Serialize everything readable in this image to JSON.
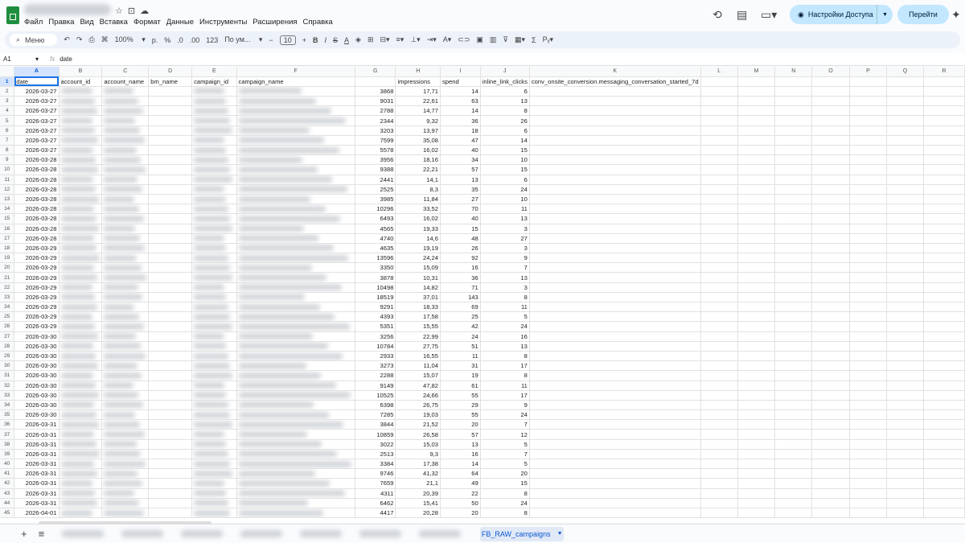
{
  "app": {
    "menu": [
      "Файл",
      "Правка",
      "Вид",
      "Вставка",
      "Формат",
      "Данные",
      "Инструменты",
      "Расширения",
      "Справка"
    ]
  },
  "header": {
    "share_label": "Настройки Доступа",
    "goto_label": "Перейти"
  },
  "toolbar": {
    "search_label": "Меню",
    "zoom": "100%",
    "currency": "р.",
    "percent": "%",
    "dec_less": ".0",
    "dec_more": ".00",
    "num_format": "123",
    "font": "По ум...",
    "font_size": "10"
  },
  "formula": {
    "cell_ref": "A1",
    "fx": "fx",
    "value": "date"
  },
  "columns": [
    "A",
    "B",
    "C",
    "D",
    "E",
    "F",
    "G",
    "H",
    "I",
    "J",
    "K",
    "L",
    "M",
    "N",
    "O",
    "P",
    "Q",
    "R"
  ],
  "headers": [
    "date",
    "account_id",
    "account_name",
    "bm_name",
    "campaign_id",
    "campaign_name",
    "impressions",
    "spend",
    "inline_link_clicks",
    "conv_onsite_conversion.messaging_conversation_started_7d"
  ],
  "rows": [
    [
      "2026-03-27",
      "3868",
      "17,71",
      "14",
      "6"
    ],
    [
      "2026-03-27",
      "9031",
      "22,61",
      "63",
      "13"
    ],
    [
      "2026-03-27",
      "2788",
      "14,77",
      "14",
      "8"
    ],
    [
      "2026-03-27",
      "2344",
      "9,32",
      "36",
      "26"
    ],
    [
      "2026-03-27",
      "3203",
      "13,97",
      "18",
      "6"
    ],
    [
      "2026-03-27",
      "7599",
      "35,08",
      "47",
      "14"
    ],
    [
      "2026-03-27",
      "5578",
      "16,02",
      "40",
      "15"
    ],
    [
      "2026-03-28",
      "3956",
      "18,16",
      "34",
      "10"
    ],
    [
      "2026-03-28",
      "9388",
      "22,21",
      "57",
      "15"
    ],
    [
      "2026-03-28",
      "2441",
      "14,1",
      "13",
      "6"
    ],
    [
      "2026-03-28",
      "2525",
      "8,3",
      "35",
      "24"
    ],
    [
      "2026-03-28",
      "3985",
      "11,84",
      "27",
      "10"
    ],
    [
      "2026-03-28",
      "10296",
      "33,52",
      "70",
      "11"
    ],
    [
      "2026-03-28",
      "6493",
      "16,02",
      "40",
      "13"
    ],
    [
      "2026-03-28",
      "4565",
      "19,33",
      "15",
      "3"
    ],
    [
      "2026-03-28",
      "4740",
      "14,6",
      "48",
      "27"
    ],
    [
      "2026-03-29",
      "4635",
      "19,19",
      "26",
      "3"
    ],
    [
      "2026-03-29",
      "13596",
      "24,24",
      "92",
      "9"
    ],
    [
      "2026-03-29",
      "3350",
      "15,09",
      "16",
      "7"
    ],
    [
      "2026-03-29",
      "3878",
      "10,31",
      "36",
      "13"
    ],
    [
      "2026-03-29",
      "10498",
      "14,82",
      "71",
      "3"
    ],
    [
      "2026-03-29",
      "18519",
      "37,01",
      "143",
      "8"
    ],
    [
      "2026-03-29",
      "9291",
      "18,33",
      "69",
      "11"
    ],
    [
      "2026-03-29",
      "4393",
      "17,58",
      "25",
      "5"
    ],
    [
      "2026-03-29",
      "5351",
      "15,55",
      "42",
      "24"
    ],
    [
      "2026-03-30",
      "3256",
      "22,99",
      "24",
      "16"
    ],
    [
      "2026-03-30",
      "10784",
      "27,75",
      "51",
      "13"
    ],
    [
      "2026-03-30",
      "2933",
      "16,55",
      "11",
      "8"
    ],
    [
      "2026-03-30",
      "3273",
      "11,04",
      "31",
      "17"
    ],
    [
      "2026-03-30",
      "2288",
      "15,07",
      "19",
      "8"
    ],
    [
      "2026-03-30",
      "9149",
      "47,82",
      "61",
      "11"
    ],
    [
      "2026-03-30",
      "10525",
      "24,66",
      "55",
      "17"
    ],
    [
      "2026-03-30",
      "6398",
      "26,75",
      "29",
      "9"
    ],
    [
      "2026-03-30",
      "7285",
      "19,03",
      "55",
      "24"
    ],
    [
      "2026-03-31",
      "3844",
      "21,52",
      "20",
      "7"
    ],
    [
      "2026-03-31",
      "10859",
      "26,58",
      "57",
      "12"
    ],
    [
      "2026-03-31",
      "3022",
      "15,03",
      "13",
      "5"
    ],
    [
      "2026-03-31",
      "2513",
      "9,3",
      "16",
      "7"
    ],
    [
      "2026-03-31",
      "3384",
      "17,38",
      "14",
      "5"
    ],
    [
      "2026-03-31",
      "9746",
      "41,32",
      "64",
      "20"
    ],
    [
      "2026-03-31",
      "7659",
      "21,1",
      "49",
      "15"
    ],
    [
      "2026-03-31",
      "4311",
      "20,39",
      "22",
      "8"
    ],
    [
      "2026-03-31",
      "6462",
      "15,41",
      "50",
      "24"
    ],
    [
      "2026-04-01",
      "4417",
      "20,28",
      "20",
      "8"
    ]
  ],
  "sheets": {
    "active": "FB_RAW_campaigns"
  }
}
